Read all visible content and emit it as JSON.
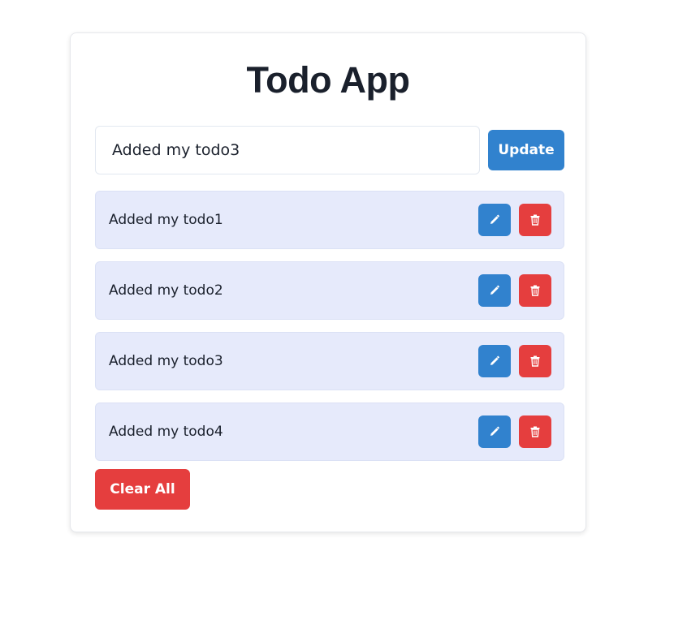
{
  "app": {
    "title": "Todo App"
  },
  "form": {
    "input_value": "Added my todo3",
    "update_label": "Update"
  },
  "todos": [
    {
      "text": "Added my todo1"
    },
    {
      "text": "Added my todo2"
    },
    {
      "text": "Added my todo3"
    },
    {
      "text": "Added my todo4"
    }
  ],
  "actions": {
    "clear_label": "Clear All",
    "edit_icon": "pencil-icon",
    "delete_icon": "trash-icon"
  },
  "colors": {
    "primary": "#3182ce",
    "danger": "#e53e3e",
    "item_bg": "#e6eafb",
    "title": "#1a202c"
  }
}
